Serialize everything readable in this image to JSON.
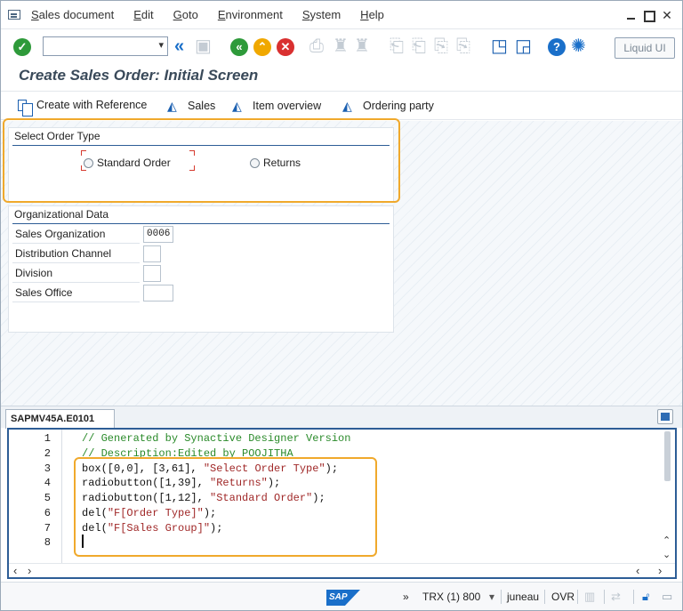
{
  "menu": {
    "items": [
      "Sales document",
      "Edit",
      "Goto",
      "Environment",
      "System",
      "Help"
    ]
  },
  "toolbar": {
    "command_value": "",
    "liquid_ui_label": "Liquid UI"
  },
  "page": {
    "title": "Create Sales Order: Initial Screen"
  },
  "app_toolbar": {
    "create_with_reference": "Create with Reference",
    "sales": "Sales",
    "item_overview": "Item overview",
    "ordering_party": "Ordering party"
  },
  "order_type_group": {
    "title": "Select Order Type",
    "standard_order": "Standard Order",
    "returns": "Returns"
  },
  "org_data": {
    "title": "Organizational Data",
    "rows": [
      {
        "label": "Sales Organization",
        "value": "0006"
      },
      {
        "label": "Distribution Channel",
        "value": ""
      },
      {
        "label": "Division",
        "value": ""
      },
      {
        "label": "Sales Office",
        "value": ""
      }
    ]
  },
  "editor": {
    "tab_label": "SAPMV45A.E0101",
    "lines": [
      {
        "num": "1",
        "text": "// Generated by Synactive Designer Version"
      },
      {
        "num": "2",
        "text": "// Description:Edited by POOJITHA"
      },
      {
        "num": "3",
        "code": "box([0,0], [3,61], ",
        "str": "\"Select Order Type\"",
        "tail": ");"
      },
      {
        "num": "4",
        "code": "radiobutton([1,39], ",
        "str": "\"Returns\"",
        "tail": ");"
      },
      {
        "num": "5",
        "code": "radiobutton([1,12], ",
        "str": "\"Standard Order\"",
        "tail": ");"
      },
      {
        "num": "6",
        "code": "del(",
        "str": "\"F[Order Type]\"",
        "tail": ");"
      },
      {
        "num": "7",
        "code": "del(",
        "str": "\"F[Sales Group]\"",
        "tail": ");"
      },
      {
        "num": "8",
        "code": "",
        "str": "",
        "tail": ""
      }
    ]
  },
  "status": {
    "sap_logo": "SAP",
    "chevron": "»",
    "transaction": "TRX (1) 800",
    "server": "juneau",
    "mode": "OVR"
  },
  "colors": {
    "highlight": "#f0a92c",
    "group_line": "#2d5d96",
    "title": "#3a4a5a"
  }
}
